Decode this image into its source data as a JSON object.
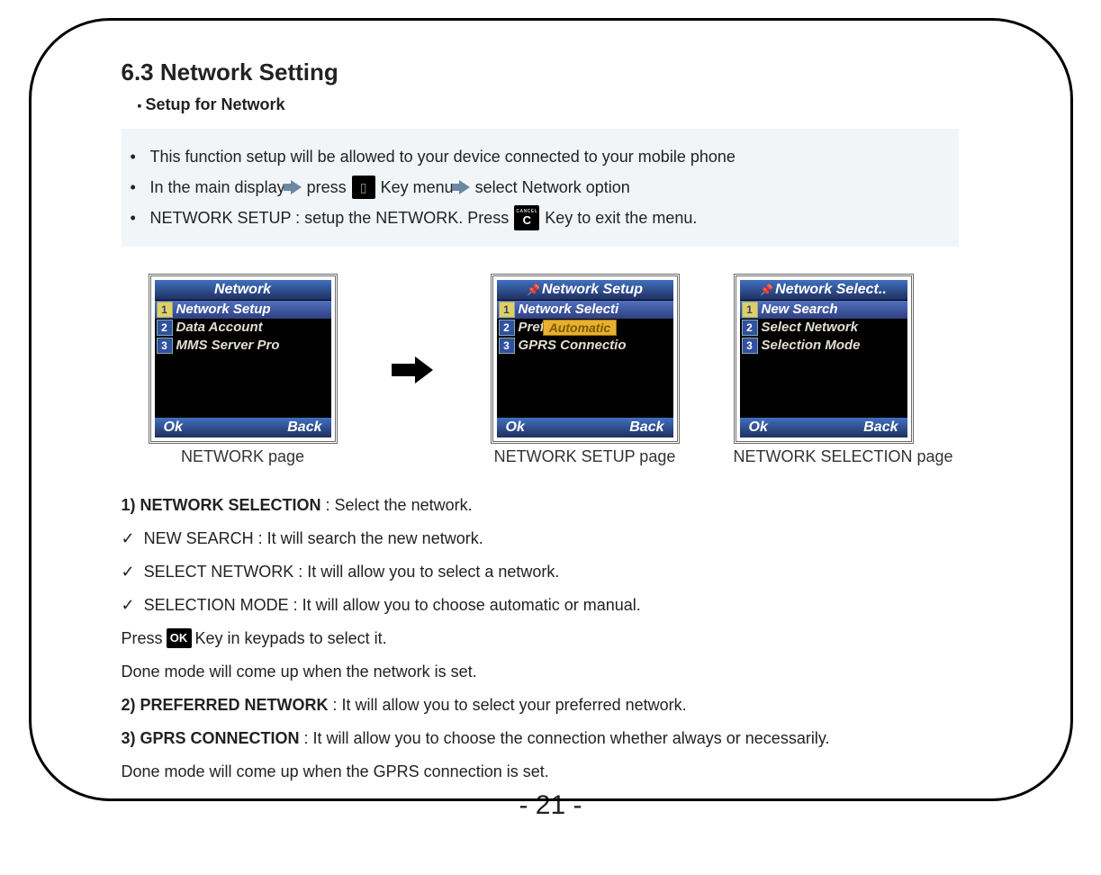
{
  "section": {
    "title": "6.3 Network Setting",
    "subtitle": "Setup for Network"
  },
  "notes": {
    "line1": "This function setup will be allowed to your device connected to your mobile phone",
    "line2a": "In the main display",
    "line2b": "press",
    "line2c": "Key menu",
    "line2d": "select Network option",
    "line3a": "NETWORK SETUP : setup the NETWORK.  Press",
    "line3b": "Key to exit the menu.",
    "cancel_small": "CANCEL",
    "cancel_c": "C",
    "phone_glyph": "▯"
  },
  "screens": {
    "s1": {
      "title": "Network",
      "items": [
        "Network Setup",
        "Data Account",
        "MMS Server Pro"
      ],
      "ok": "Ok",
      "back": "Back",
      "caption": "NETWORK page"
    },
    "s2": {
      "title": "Network Setup",
      "items": [
        "Network Selecti",
        "Pref",
        "GPRS Connectio"
      ],
      "popup": "Automatic",
      "ok": "Ok",
      "back": "Back",
      "caption": "NETWORK SETUP page"
    },
    "s3": {
      "title": "Network Select..",
      "items": [
        "New Search",
        "Select Network",
        "Selection Mode"
      ],
      "ok": "Ok",
      "back": "Back",
      "caption": "NETWORK SELECTION page"
    }
  },
  "body": {
    "h1_label": "1)  NETWORK SELECTION",
    "h1_rest": " : Select the network.",
    "c1": "NEW SEARCH : It will search the new network.",
    "c2": "SELECT NETWORK : It will allow you to select a network.",
    "c3": "SELECTION MODE : It will allow you to choose automatic or manual.",
    "c3_indent_a": "Press",
    "c3_indent_b": "Key  in keypads to select it.",
    "c3_indent_c": "Done mode will come up when the network is set.",
    "h2_label": "2) PREFERRED NETWORK",
    "h2_rest": " : It will allow you to select your preferred network.",
    "h3_label": "3) GPRS CONNECTION",
    "h3_rest": " : It will allow you to choose the connection whether always or necessarily.",
    "h3_indent": "Done mode will come up when the GPRS connection is set.",
    "ok_key": "OK"
  },
  "page_number": "- 21 -"
}
